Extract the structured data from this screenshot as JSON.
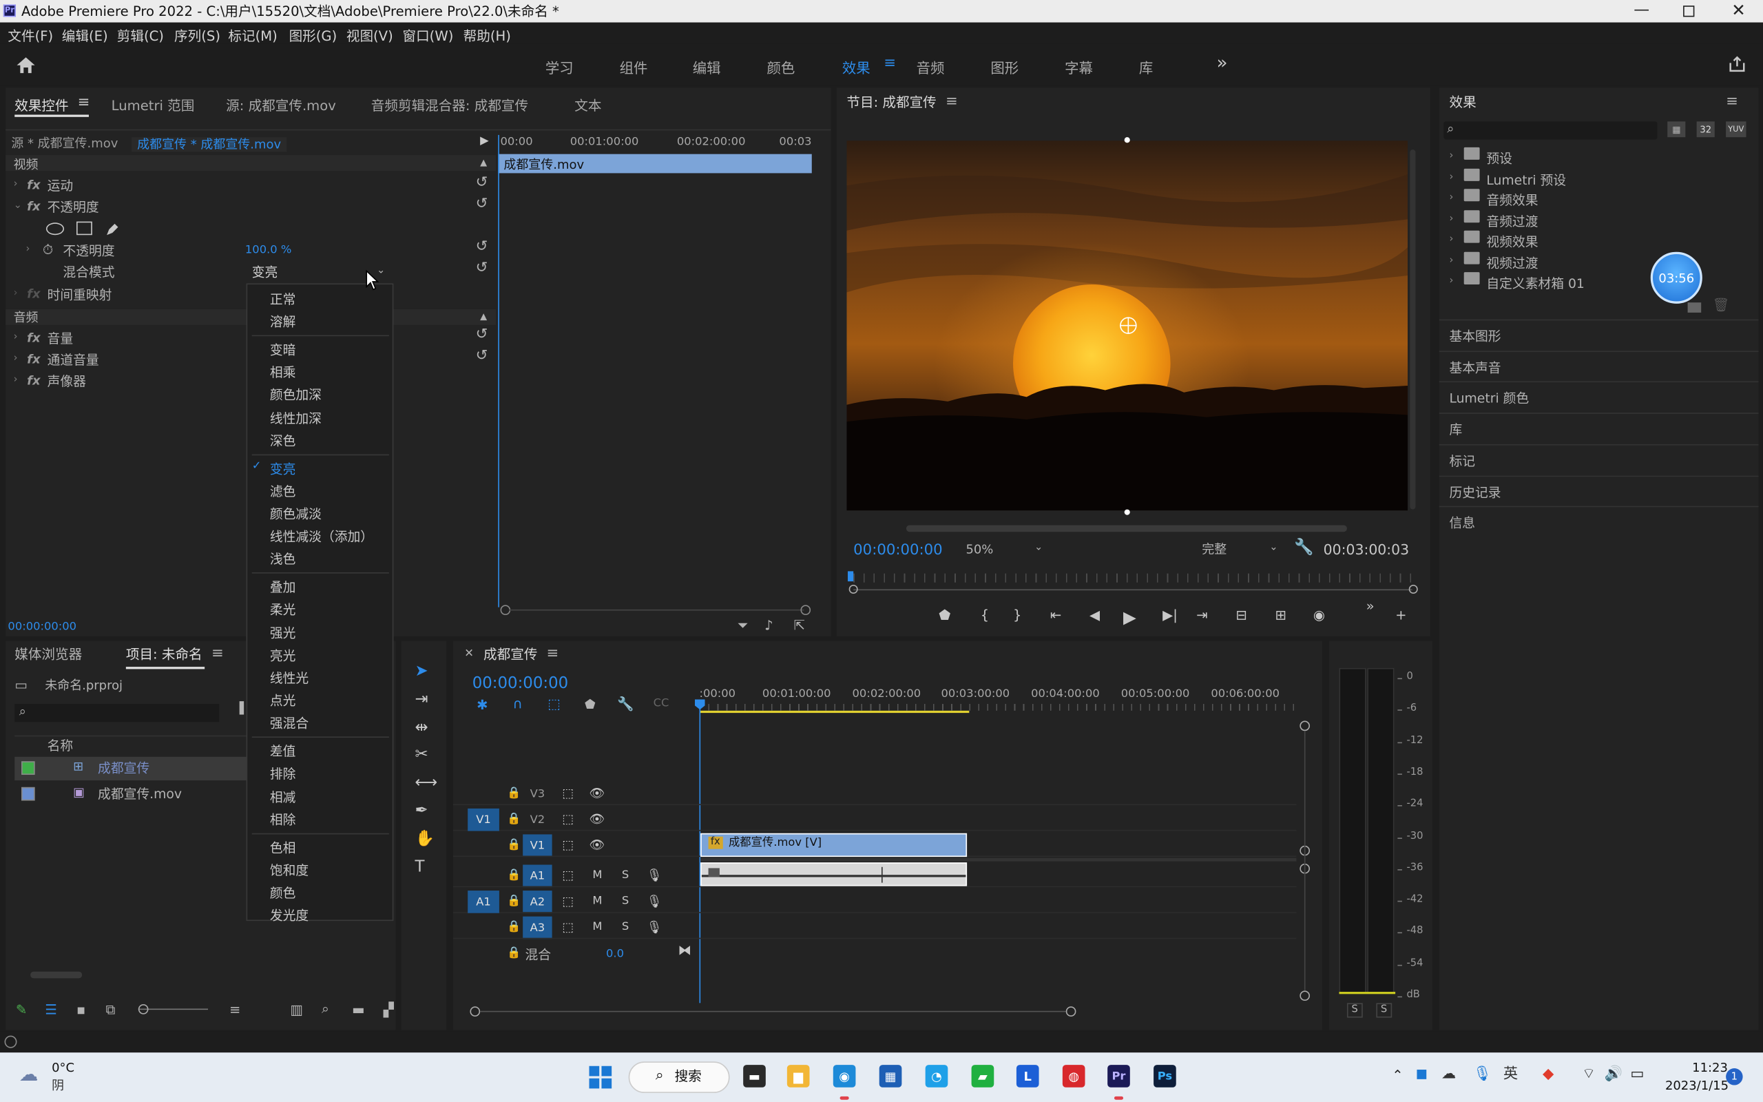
{
  "app": {
    "title": "Adobe Premiere Pro 2022 - C:\\用户\\15520\\文档\\Adobe\\Premiere Pro\\22.0\\未命名 *"
  },
  "menu": [
    "文件(F)",
    "编辑(E)",
    "剪辑(C)",
    "序列(S)",
    "标记(M)",
    "图形(G)",
    "视图(V)",
    "窗口(W)",
    "帮助(H)"
  ],
  "workspaces": [
    "学习",
    "组件",
    "编辑",
    "颜色",
    "效果",
    "音频",
    "图形",
    "字幕",
    "库"
  ],
  "active_workspace": "效果",
  "source_tabs": [
    "效果控件",
    "Lumetri 范围",
    "源: 成都宣传.mov",
    "音频剪辑混合器: 成都宣传",
    "文本"
  ],
  "effect_controls": {
    "source_label": "源 * 成都宣传.mov",
    "seq_label": "成都宣传 * 成都宣传.mov",
    "ruler": [
      "00:00",
      "00:01:00:00",
      "00:02:00:00",
      "00:03"
    ],
    "clip_label": "成都宣传.mov",
    "video_header": "视频",
    "motion": "运动",
    "opacity_group": "不透明度",
    "opacity_param": "不透明度",
    "opacity_value": "100.0 %",
    "blend_label": "混合模式",
    "blend_value": "变亮",
    "time_remap": "时间重映射",
    "audio_header": "音频",
    "volume": "音量",
    "channel_volume": "通道音量",
    "panner": "声像器",
    "timecode": "00:00:00:00"
  },
  "blend_modes": [
    [
      "正常",
      "溶解"
    ],
    [
      "变暗",
      "相乘",
      "颜色加深",
      "线性加深",
      "深色"
    ],
    [
      "变亮",
      "滤色",
      "颜色减淡",
      "线性减淡（添加）",
      "浅色"
    ],
    [
      "叠加",
      "柔光",
      "强光",
      "亮光",
      "线性光",
      "点光",
      "强混合"
    ],
    [
      "差值",
      "排除",
      "相减",
      "相除"
    ],
    [
      "色相",
      "饱和度",
      "颜色",
      "发光度"
    ]
  ],
  "program": {
    "title": "节目: 成都宣传",
    "timecode": "00:00:00:00",
    "zoom": "50%",
    "quality": "完整",
    "duration": "00:03:00:03"
  },
  "effects_panel": {
    "title": "效果",
    "folders": [
      "预设",
      "Lumetri 预设",
      "音频效果",
      "音频过渡",
      "视频效果",
      "视频过渡",
      "自定义素材箱 01"
    ],
    "sections": [
      "基本图形",
      "基本声音",
      "Lumetri 颜色",
      "库",
      "标记",
      "历史记录",
      "信息"
    ],
    "timer": "03:56"
  },
  "project": {
    "tabs": [
      "媒体浏览器",
      "项目: 未命名"
    ],
    "file": "未命名.prproj",
    "col_name": "名称",
    "items": [
      "成都宣传",
      "成都宣传.mov"
    ],
    "item_colors": [
      "#3fae49",
      "#6a8fd0"
    ]
  },
  "timeline": {
    "title": "成都宣传",
    "timecode": "00:00:00:00",
    "ruler": [
      ":00:00",
      "00:01:00:00",
      "00:02:00:00",
      "00:03:00:00",
      "00:04:00:00",
      "00:05:00:00",
      "00:06:00:00"
    ],
    "video_tracks": [
      "V3",
      "V2",
      "V1"
    ],
    "audio_tracks": [
      "A1",
      "A2",
      "A3"
    ],
    "src_v": "V1",
    "src_a": "A1",
    "mix_label": "混合",
    "mix_value": "0.0",
    "clip_v": "成都宣传.mov [V]",
    "m_label": "M",
    "s_label": "S"
  },
  "meter": {
    "ticks": [
      "0",
      "-6",
      "-12",
      "-18",
      "-24",
      "-30",
      "-36",
      "-42",
      "-48",
      "-54",
      "dB"
    ],
    "solo": [
      "S",
      "S"
    ]
  },
  "taskbar": {
    "weather_temp": "0°C",
    "weather_desc": "阴",
    "search": "搜索",
    "time": "11:23",
    "date": "2023/1/15",
    "notif": "1"
  },
  "colors": {
    "accent": "#2d8ceb",
    "clip_video": "#7ca4d8",
    "track_blue": "#1e5a95"
  }
}
